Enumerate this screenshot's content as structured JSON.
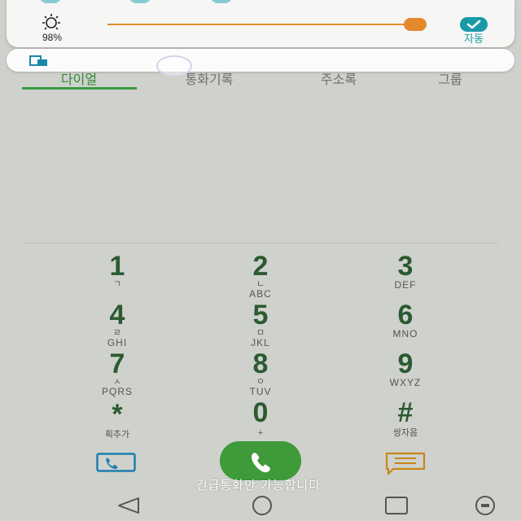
{
  "brightness": {
    "percent_label": "98%",
    "level": 0.98,
    "auto_label": "자동",
    "auto_enabled": true,
    "accent_color": "#e48a2d"
  },
  "mini_bar": {
    "icon": "screen-share-icon"
  },
  "tabs": [
    {
      "label": "다이얼",
      "active": true
    },
    {
      "label": "통화기록",
      "active": false
    },
    {
      "label": "주소록",
      "active": false
    },
    {
      "label": "그룹",
      "active": false
    }
  ],
  "dialpad": {
    "keys": [
      {
        "digit": "1",
        "sub1": "ㄱ",
        "sub2": ""
      },
      {
        "digit": "2",
        "sub1": "ㄴ",
        "sub2": "ABC"
      },
      {
        "digit": "3",
        "sub1": "",
        "sub2": "DEF"
      },
      {
        "digit": "4",
        "sub1": "ㄹ",
        "sub2": "GHI"
      },
      {
        "digit": "5",
        "sub1": "ㅁ",
        "sub2": "JKL"
      },
      {
        "digit": "6",
        "sub1": "",
        "sub2": "MNO"
      },
      {
        "digit": "7",
        "sub1": "ㅅ",
        "sub2": "PQRS"
      },
      {
        "digit": "8",
        "sub1": "ㅇ",
        "sub2": "TUV"
      },
      {
        "digit": "9",
        "sub1": "",
        "sub2": "WXYZ"
      },
      {
        "digit": "*",
        "sub1": "",
        "sub2": "",
        "sub3": "획추가"
      },
      {
        "digit": "0",
        "sub1": "",
        "sub2": "",
        "sub3": "+"
      },
      {
        "digit": "#",
        "sub1": "",
        "sub2": "",
        "sub3": "쌍자음"
      }
    ]
  },
  "actions": {
    "video_icon": "video-call-icon",
    "call_icon": "phone-icon",
    "message_icon": "message-icon",
    "call_color": "#3f9a3a"
  },
  "emergency_text": "긴급통화만 가능합니다.",
  "nav": {
    "back_icon": "back-icon",
    "home_icon": "home-icon",
    "recents_icon": "recents-icon",
    "extra_icon": "dual-window-icon"
  }
}
